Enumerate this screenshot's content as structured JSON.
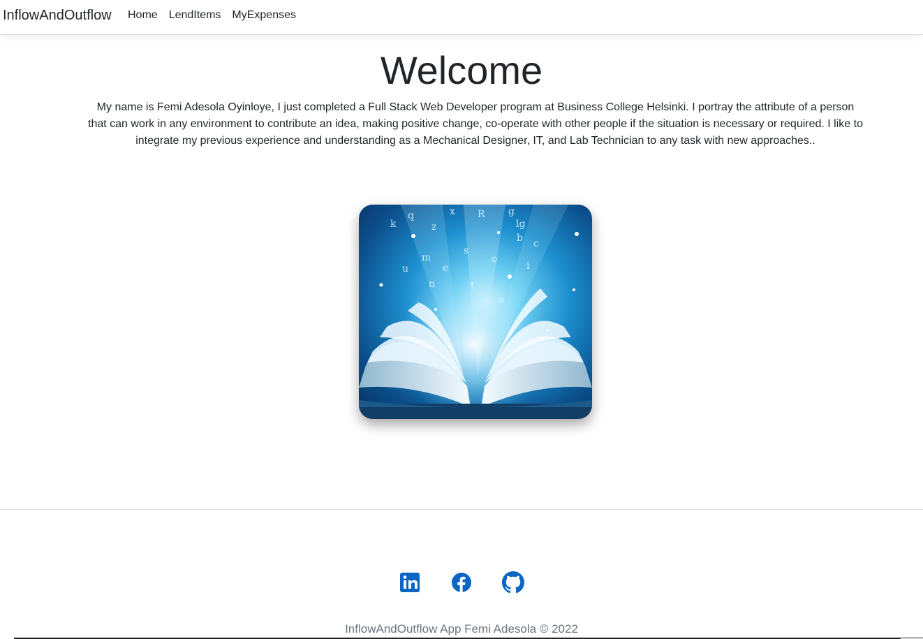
{
  "navbar": {
    "brand": "InflowAndOutflow",
    "links": [
      {
        "label": "Home"
      },
      {
        "label": "LendItems"
      },
      {
        "label": "MyExpenses"
      }
    ]
  },
  "main": {
    "title": "Welcome",
    "intro": "My name is Femi Adesola Oyinloye, I just completed a Full Stack Web Developer program at Business College Helsinki. I portray the attribute of a person that can work in any environment to contribute an idea, making positive change, co-operate with other people if the situation is necessary or required. I like to integrate my previous experience and understanding as a Mechanical Designer, IT, and Lab Technician to any task with new approaches.."
  },
  "footer": {
    "socials": [
      {
        "icon": "linkedin-icon"
      },
      {
        "icon": "facebook-icon"
      },
      {
        "icon": "github-icon"
      }
    ],
    "copyright": "InflowAndOutflow App Femi Adesola © 2022"
  },
  "colors": {
    "text": "#212529",
    "social_icon": "#0a66c2",
    "muted": "#6c757d",
    "divider": "#dee2e6"
  }
}
